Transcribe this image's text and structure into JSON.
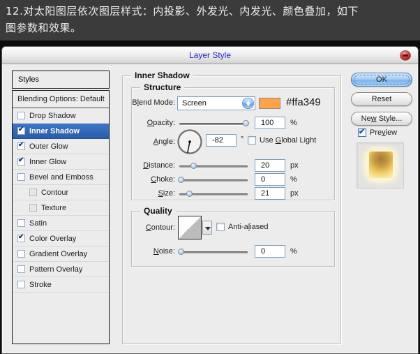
{
  "banner": {
    "line1": "12.对太阳图层依次图层样式：内投影、外发光、内发光、颜色叠加，如下",
    "line2": "图参数和效果。"
  },
  "dialog": {
    "title": "Layer Style",
    "accent_colors": {
      "selection_blue": "#2e63b8",
      "title_blue": "#2424cf",
      "aqua_button": "#7fb2ec"
    },
    "sidebar": {
      "header": "Styles",
      "items": [
        {
          "label": "Blending Options: Default",
          "type": "plain"
        },
        {
          "label": "Drop Shadow",
          "checked": false
        },
        {
          "label": "Inner Shadow",
          "checked": true,
          "selected": true
        },
        {
          "label": "Outer Glow",
          "checked": true
        },
        {
          "label": "Inner Glow",
          "checked": true
        },
        {
          "label": "Bevel and Emboss",
          "checked": false
        },
        {
          "label": "Contour",
          "checked": false,
          "indent": true,
          "disabled": true
        },
        {
          "label": "Texture",
          "checked": false,
          "indent": true,
          "disabled": true
        },
        {
          "label": "Satin",
          "checked": false
        },
        {
          "label": "Color Overlay",
          "checked": true
        },
        {
          "label": "Gradient Overlay",
          "checked": false
        },
        {
          "label": "Pattern Overlay",
          "checked": false
        },
        {
          "label": "Stroke",
          "checked": false
        }
      ]
    },
    "panel": {
      "legend": "Inner Shadow",
      "structure": {
        "legend": "Structure",
        "blend_mode": {
          "label": {
            "pre": "B",
            "key": "l",
            "post": "end Mode:"
          },
          "value": "Screen",
          "swatch_color": "#ffa349",
          "hex_label": "#ffa349"
        },
        "opacity": {
          "label": {
            "pre": "",
            "key": "O",
            "post": "pacity:"
          },
          "value": "100",
          "unit": "%",
          "percent": 97
        },
        "angle": {
          "label": {
            "pre": "",
            "key": "A",
            "post": "ngle:"
          },
          "value": "-82",
          "unit": "°",
          "global_light": {
            "pre": "Use ",
            "key": "G",
            "post": "lobal Light"
          },
          "global_checked": false
        },
        "distance": {
          "label": {
            "pre": "",
            "key": "D",
            "post": "istance:"
          },
          "value": "20",
          "unit": "px",
          "percent": 20
        },
        "choke": {
          "label": {
            "pre": "",
            "key": "C",
            "post": "hoke:"
          },
          "value": "0",
          "unit": "%",
          "percent": 2
        },
        "size": {
          "label": {
            "pre": "",
            "key": "S",
            "post": "ize:"
          },
          "value": "21",
          "unit": "px",
          "percent": 14
        }
      },
      "quality": {
        "legend": "Quality",
        "contour": {
          "label": {
            "pre": "",
            "key": "C",
            "post": "ontour:"
          },
          "anti_aliased": {
            "pre": "Anti-a",
            "key": "l",
            "post": "iased"
          },
          "aa_checked": false
        },
        "noise": {
          "label": {
            "pre": "",
            "key": "N",
            "post": "oise:"
          },
          "value": "0",
          "unit": "%",
          "percent": 2
        }
      }
    },
    "buttons": {
      "ok": "OK",
      "reset": "Reset",
      "new_style": {
        "pre": "Ne",
        "key": "w",
        "post": " Style..."
      },
      "preview": {
        "pre": "Pre",
        "key": "v",
        "post": "iew"
      },
      "preview_checked": true
    }
  }
}
